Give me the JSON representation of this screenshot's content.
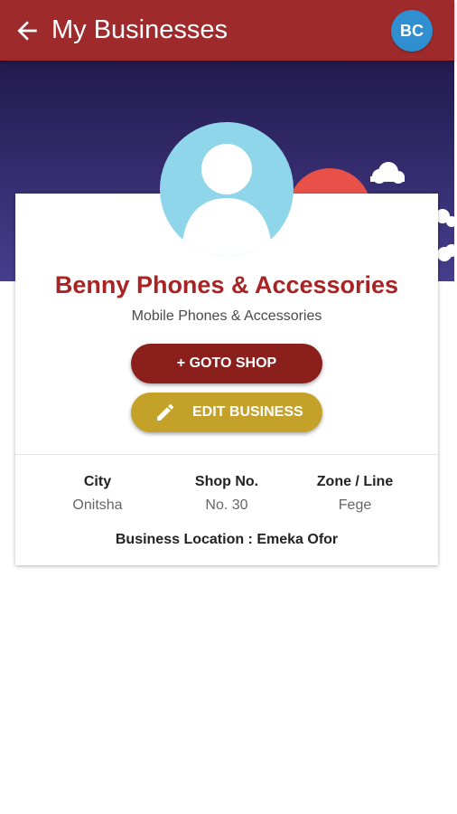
{
  "appbar": {
    "title": "My Businesses",
    "user_initials": "BC",
    "color": "#9e2a2b"
  },
  "business": {
    "name": "Benny Phones & Accessories",
    "category": "Mobile Phones & Accessories",
    "name_color": "#a82424"
  },
  "actions": {
    "goto_shop": "+ GOTO SHOP",
    "edit_business": "EDIT BUSINESS",
    "goto_color": "#8b1f1c",
    "edit_color": "#c4a128"
  },
  "details": {
    "city_label": "City",
    "city_value": "Onitsha",
    "shop_label": "Shop No.",
    "shop_value": "No. 30",
    "zone_label": "Zone / Line",
    "zone_value": "Fege",
    "location": "Business Location : Emeka Ofor"
  },
  "icons": {
    "back": "arrow-left-icon",
    "edit": "pencil-icon",
    "avatar": "person-silhouette-icon"
  }
}
